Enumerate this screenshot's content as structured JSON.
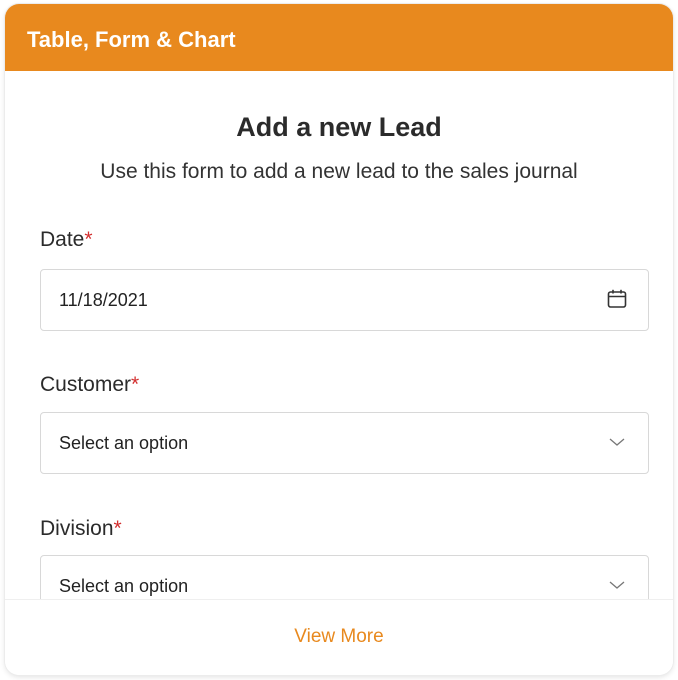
{
  "header": {
    "title": "Table, Form & Chart"
  },
  "form": {
    "title": "Add a new Lead",
    "subtitle": "Use this form to add a new lead to the sales journal",
    "required_marker": "*",
    "fields": [
      {
        "label": "Date",
        "value": "11/18/2021",
        "icon": "calendar-icon"
      },
      {
        "label": "Customer",
        "value": "Select an option",
        "icon": "chevron-down-icon"
      },
      {
        "label": "Division",
        "value": "Select an option",
        "icon": "chevron-down-icon"
      }
    ]
  },
  "footer": {
    "view_more_label": "View More"
  },
  "colors": {
    "accent": "#e8891e",
    "required": "#d32f2f"
  }
}
